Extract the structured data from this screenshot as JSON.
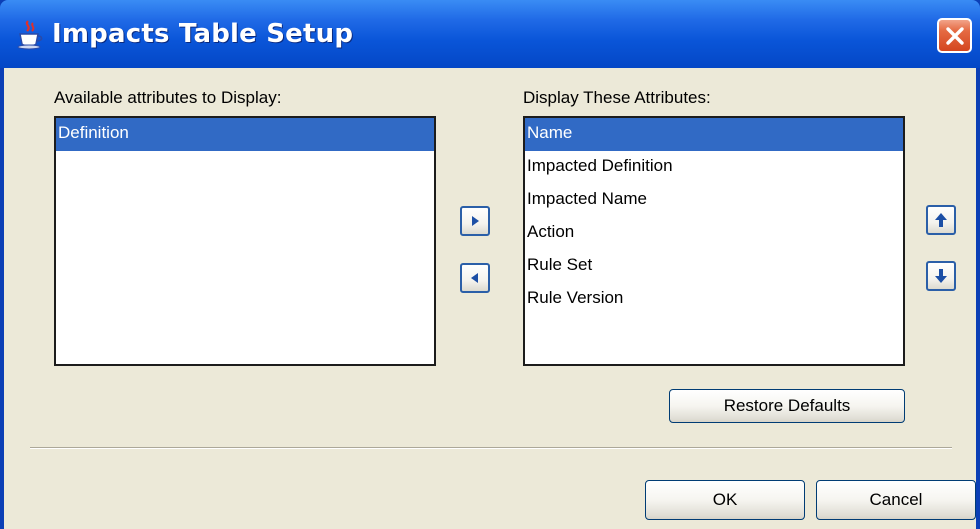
{
  "window": {
    "title": "Impacts Table Setup",
    "title_icon": "java-coffee-cup-icon",
    "close_icon": "close-icon"
  },
  "available": {
    "label": "Available attributes to Display:",
    "items": [
      "Definition"
    ],
    "selected_index": 0
  },
  "display": {
    "label": "Display These Attributes:",
    "items": [
      "Name",
      "Impacted Definition",
      "Impacted Name",
      "Action",
      "Rule Set",
      "Rule Version"
    ],
    "selected_index": 0
  },
  "buttons": {
    "add_icon": "arrow-right-icon",
    "remove_icon": "arrow-left-icon",
    "move_up_icon": "arrow-up-icon",
    "move_down_icon": "arrow-down-icon",
    "restore_defaults": "Restore Defaults",
    "ok": "OK",
    "cancel": "Cancel"
  },
  "colors": {
    "title_bar": "#0a55d8",
    "selection": "#316ac5",
    "dialog_background": "#ece9d8",
    "close_button": "#d4461f"
  }
}
